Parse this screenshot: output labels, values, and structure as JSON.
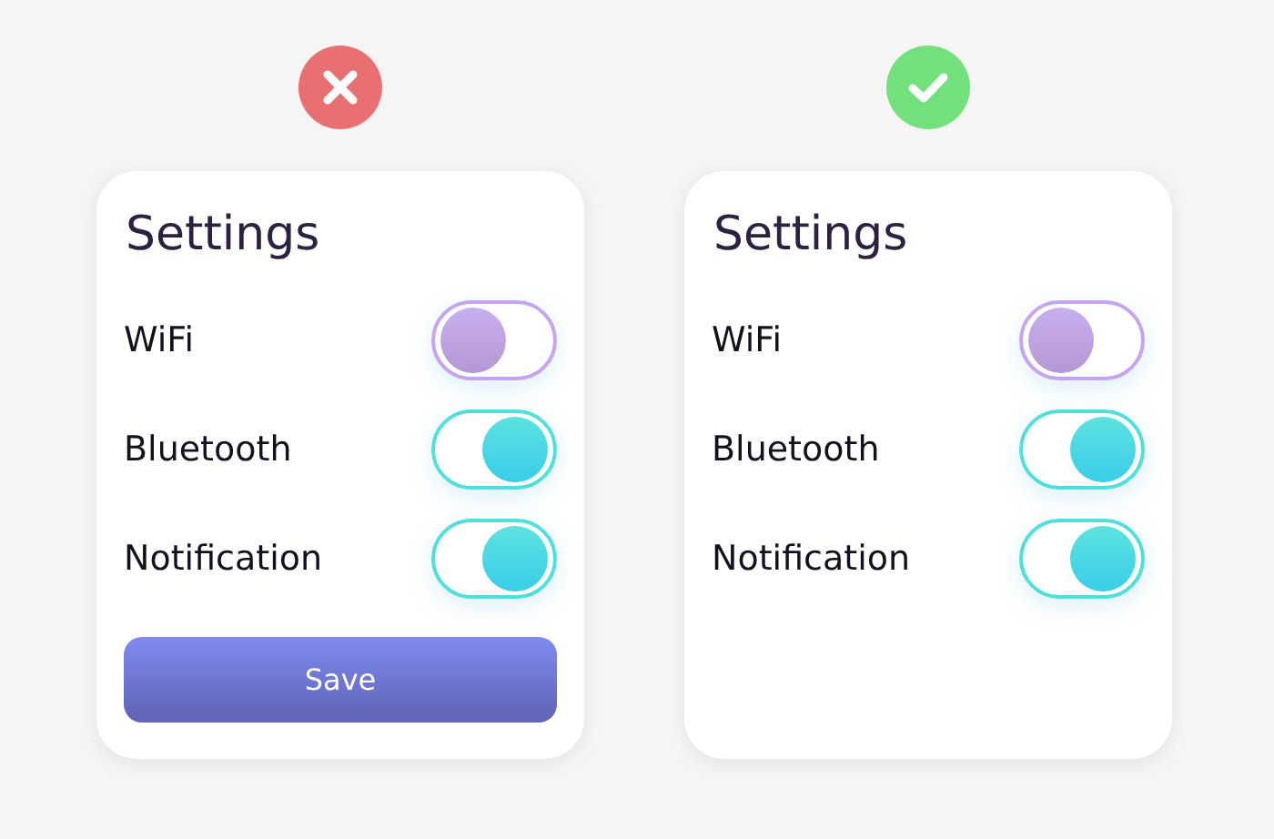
{
  "panels": [
    {
      "kind": "wrong",
      "title": "Settings",
      "toggles": [
        {
          "label": "WiFi",
          "on": false
        },
        {
          "label": "Bluetooth",
          "on": true
        },
        {
          "label": "Notification",
          "on": true
        }
      ],
      "button": "Save"
    },
    {
      "kind": "right",
      "title": "Settings",
      "toggles": [
        {
          "label": "WiFi",
          "on": false
        },
        {
          "label": "Bluetooth",
          "on": true
        },
        {
          "label": "Notification",
          "on": true
        }
      ]
    }
  ]
}
